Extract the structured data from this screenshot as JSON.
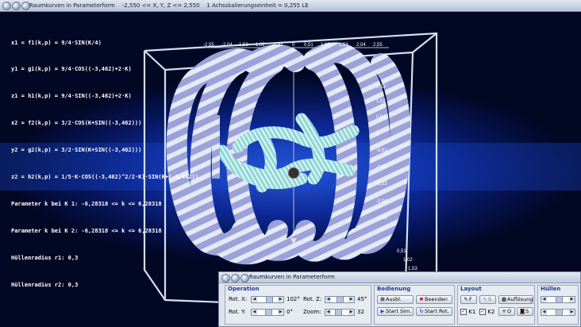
{
  "window": {
    "title": "Raumkurven in Parameterform",
    "range": "-2,550 <= X, Y, Z <= 2,550",
    "scale": "1 Achsskalierungseinheit = 0,255 LE"
  },
  "formulas": [
    "x1 = f1(k,p) = 9/4·SIN(K/4)",
    "y1 = g1(k,p) = 9/4·COS((-3,462)+2·K)",
    "z1 = h1(k,p) = 9/4·SIN((-3,462)+2·K)",
    "x2 = f2(k,p) = 3/2·COS(K+SIN((-3,462)))",
    "y2 = g2(k,p) = 3/2·SIN(K+SIN((-3,462)))",
    "z2 = h2(k,p) = 1/5·K·COS((-3,462)^2/2·K)·SIN(K+(-3,462))",
    "Parameter k bei K 1: -6,28318 <= k <= 6,28318",
    "Parameter k bei K 2: -6,28318 <= k <= 6,28318",
    "Hüllenradius r1: 0,3",
    "Hüllenradius r2: 0,3"
  ],
  "axis_ticks": {
    "top": [
      "-2,55",
      "-2,04",
      "-1,53",
      "-1,02",
      "-0,51",
      "0",
      "0,51",
      "1,02",
      "1,53",
      "2,04",
      "2,55"
    ],
    "right": [
      "1,53",
      "1,02",
      "0,51",
      "0",
      "-0,51",
      "-1,02",
      "-1,53",
      "-2,04",
      "-2,55"
    ],
    "bottom": [
      "0,51",
      "1,02",
      "1,53"
    ]
  },
  "panel": {
    "title": "Raumkurven in Parameterform",
    "operation": {
      "title": "Operation",
      "rot_x_label": "Rot. X:",
      "rot_x_value": "102°",
      "rot_y_label": "Rot. Y:",
      "rot_y_value": "0°",
      "rot_z_label": "Rot. Z:",
      "rot_z_value": "45°",
      "zoom_label": "Zoom:",
      "zoom_value": "32"
    },
    "bedienung": {
      "title": "Bedienung",
      "ausbl": "Ausbl.",
      "beenden": "Beenden",
      "start_sim": "Start Sim.",
      "start_rot": "Start Rot."
    },
    "layout": {
      "title": "Layout",
      "f_btn": "F",
      "b_btn": "B",
      "aufloesung": "Auflösung",
      "k1": "K1",
      "k2": "K2",
      "o_btn": "O",
      "s_btn": "S"
    },
    "huellen": {
      "title": "Hüllen"
    }
  }
}
